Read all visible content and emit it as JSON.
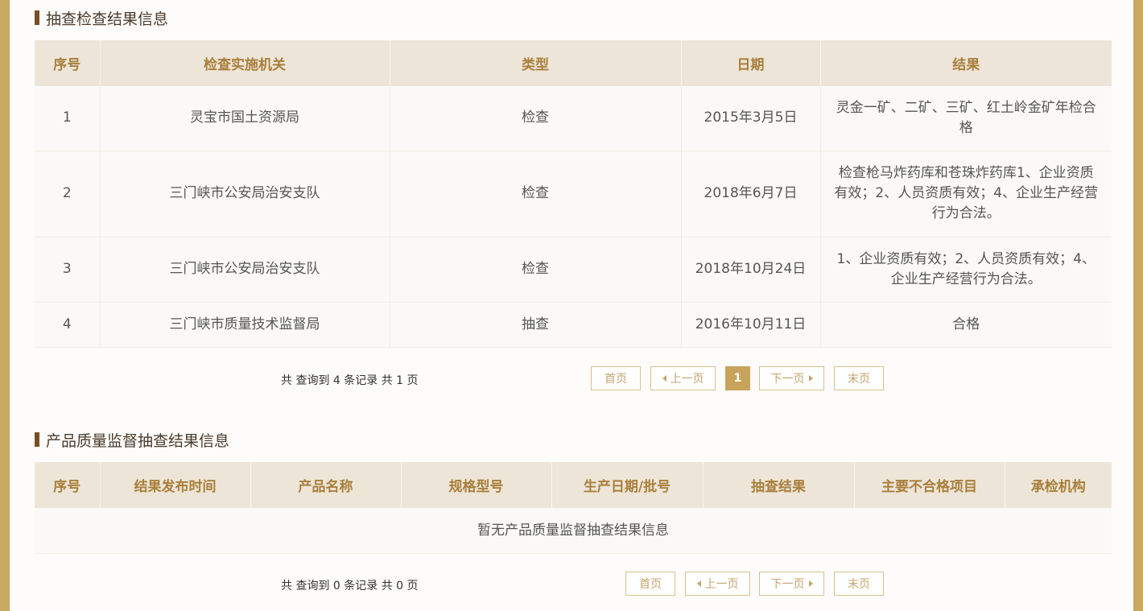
{
  "inspection": {
    "title": "抽查检查结果信息",
    "headers": [
      "序号",
      "检查实施机关",
      "类型",
      "日期",
      "结果"
    ],
    "rows": [
      [
        "1",
        "灵宝市国土资源局",
        "检查",
        "2015年3月5日",
        "灵金一矿、二矿、三矿、红土岭金矿年检合格"
      ],
      [
        "2",
        "三门峡市公安局治安支队",
        "检查",
        "2018年6月7日",
        "检查枪马炸药库和苍珠炸药库1、企业资质有效；2、人员资质有效；4、企业生产经营行为合法。"
      ],
      [
        "3",
        "三门峡市公安局治安支队",
        "检查",
        "2018年10月24日",
        "1、企业资质有效；2、人员资质有效；4、企业生产经营行为合法。"
      ],
      [
        "4",
        "三门峡市质量技术监督局",
        "抽查",
        "2016年10月11日",
        "合格"
      ]
    ],
    "pager": {
      "summary": "共 查询到 4 条记录 共 1 页",
      "first": "首页",
      "prev": "上一页",
      "current": "1",
      "next": "下一页",
      "last": "末页"
    }
  },
  "quality": {
    "title": "产品质量监督抽查结果信息",
    "headers": [
      "序号",
      "结果发布时间",
      "产品名称",
      "规格型号",
      "生产日期/批号",
      "抽查结果",
      "主要不合格项目",
      "承检机构"
    ],
    "empty_text": "暂无产品质量监督抽查结果信息",
    "pager": {
      "summary": "共 查询到 0 条记录 共 0 页",
      "first": "首页",
      "prev": "上一页",
      "next": "下一页",
      "last": "末页"
    }
  },
  "colors": {
    "frame": "#c9a85f",
    "header_bg": "#ede5d8",
    "header_text": "#a97f3b",
    "title_bar": "#7a4e25",
    "active_page": "#c9a35a"
  }
}
